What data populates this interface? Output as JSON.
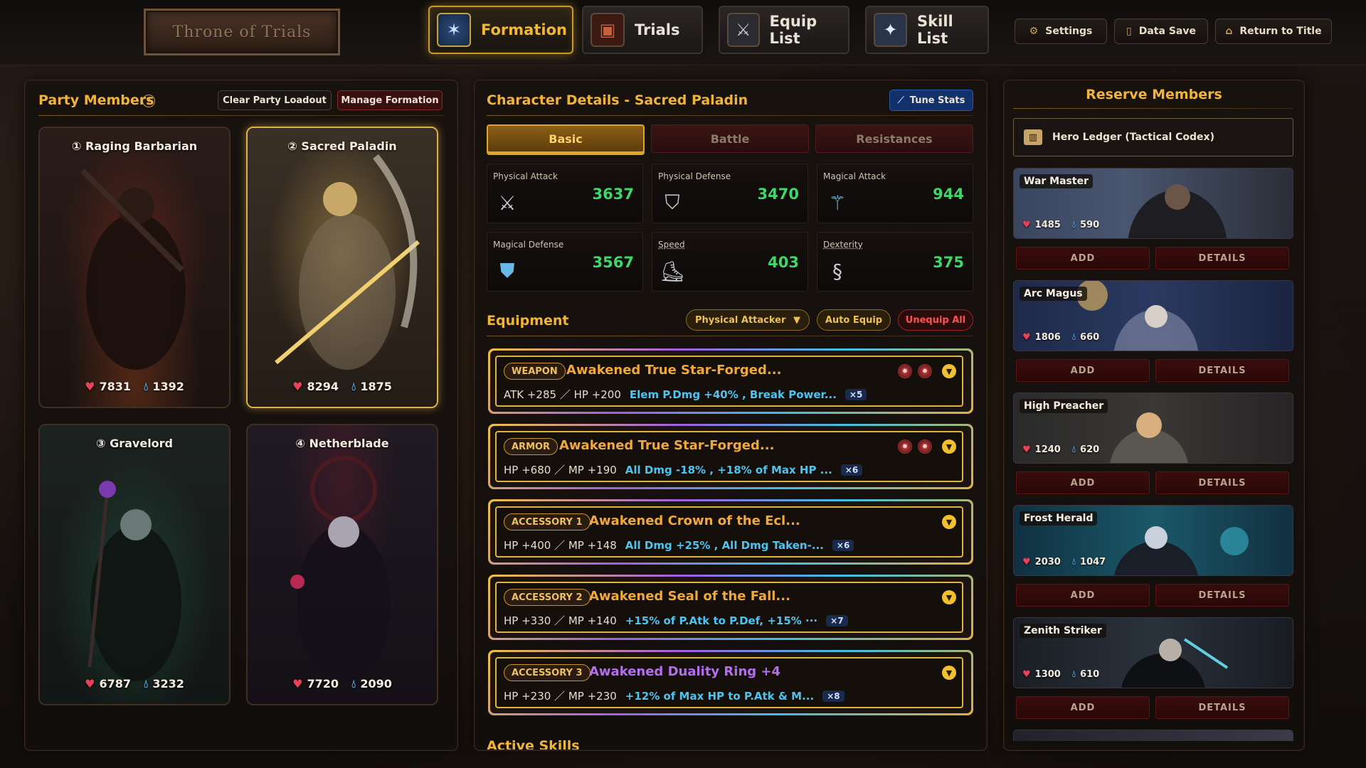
{
  "logo_text": "Throne of Trials",
  "nav": [
    {
      "label": "Formation",
      "icon": "formation-icon"
    },
    {
      "label": "Trials",
      "icon": "trials-icon"
    },
    {
      "label": "Equip List",
      "icon": "equip-icon"
    },
    {
      "label": "Skill List",
      "icon": "skill-icon"
    }
  ],
  "system": {
    "settings": "Settings",
    "data_save": "Data Save",
    "return_title": "Return to Title"
  },
  "party": {
    "title": "Party Members",
    "help": "?",
    "clear_btn": "Clear Party Loadout",
    "manage_btn": "Manage Formation",
    "members": [
      {
        "name": "① Raging Barbarian",
        "hp": "7831",
        "mp": "1392"
      },
      {
        "name": "② Sacred Paladin",
        "hp": "8294",
        "mp": "1875"
      },
      {
        "name": "③ Gravelord",
        "hp": "6787",
        "mp": "3232"
      },
      {
        "name": "④ Netherblade",
        "hp": "7720",
        "mp": "2090"
      }
    ]
  },
  "details": {
    "title": "Character Details - Sacred Paladin",
    "tune_btn": "Tune Stats",
    "tabs": [
      "Basic",
      "Battle",
      "Resistances"
    ],
    "stats": [
      {
        "label": "Physical Attack",
        "value": "3637",
        "icon": "crossed-swords-icon"
      },
      {
        "label": "Physical Defense",
        "value": "3470",
        "icon": "shield-icon"
      },
      {
        "label": "Magical Attack",
        "value": "944",
        "icon": "wand-icon"
      },
      {
        "label": "Magical Defense",
        "value": "3567",
        "icon": "magic-shield-icon"
      },
      {
        "label": "Speed",
        "value": "403",
        "icon": "boot-icon"
      },
      {
        "label": "Dexterity",
        "value": "375",
        "icon": "serpent-icon"
      }
    ],
    "equipment_title": "Equipment",
    "preset": "Physical Attacker",
    "auto_equip": "Auto Equip",
    "unequip_all": "Unequip All",
    "equipment": [
      {
        "slot": "WEAPON",
        "name": "Awakened True Star-Forged...",
        "base": "ATK +285 ／ HP +200",
        "effects": "Elem P.Dmg +40% , Break Power...",
        "count": "×5"
      },
      {
        "slot": "ARMOR",
        "name": "Awakened True Star-Forged...",
        "base": "HP +680 ／ MP +190",
        "effects": "All Dmg -18% , +18% of Max HP ...",
        "count": "×6"
      },
      {
        "slot": "ACCESSORY 1",
        "name": "Awakened Crown of the Ecl...",
        "base": "HP +400 ／ MP +148",
        "effects": "All Dmg +25% , All Dmg Taken-...",
        "count": "×6"
      },
      {
        "slot": "ACCESSORY 2",
        "name": "Awakened Seal of the Fall...",
        "base": "HP +330 ／ MP +140",
        "effects": "+15% of P.Atk to P.Def, +15% ···",
        "count": "×7"
      },
      {
        "slot": "ACCESSORY 3",
        "name": "Awakened Duality Ring +4",
        "base": "HP +230 ／ MP +230",
        "effects": "+12% of Max HP to P.Atk & M...",
        "count": "×8"
      }
    ],
    "active_skills_title": "Active Skills"
  },
  "reserve": {
    "title": "Reserve Members",
    "ledger": "Hero Ledger (Tactical Codex)",
    "add_label": "ADD",
    "details_label": "DETAILS",
    "members": [
      {
        "name": "War Master",
        "hp": "1485",
        "mp": "590"
      },
      {
        "name": "Arc Magus",
        "hp": "1806",
        "mp": "660"
      },
      {
        "name": "High Preacher",
        "hp": "1240",
        "mp": "620"
      },
      {
        "name": "Frost Herald",
        "hp": "2030",
        "mp": "1047"
      },
      {
        "name": "Zenith Striker",
        "hp": "1300",
        "mp": "610"
      }
    ]
  },
  "colors": {
    "accent_gold": "#f0b43a",
    "stat_green": "#3fd66a",
    "effect_blue": "#4cc4f0",
    "hp_red": "#e8415a",
    "mp_blue": "#4fa8e8"
  }
}
